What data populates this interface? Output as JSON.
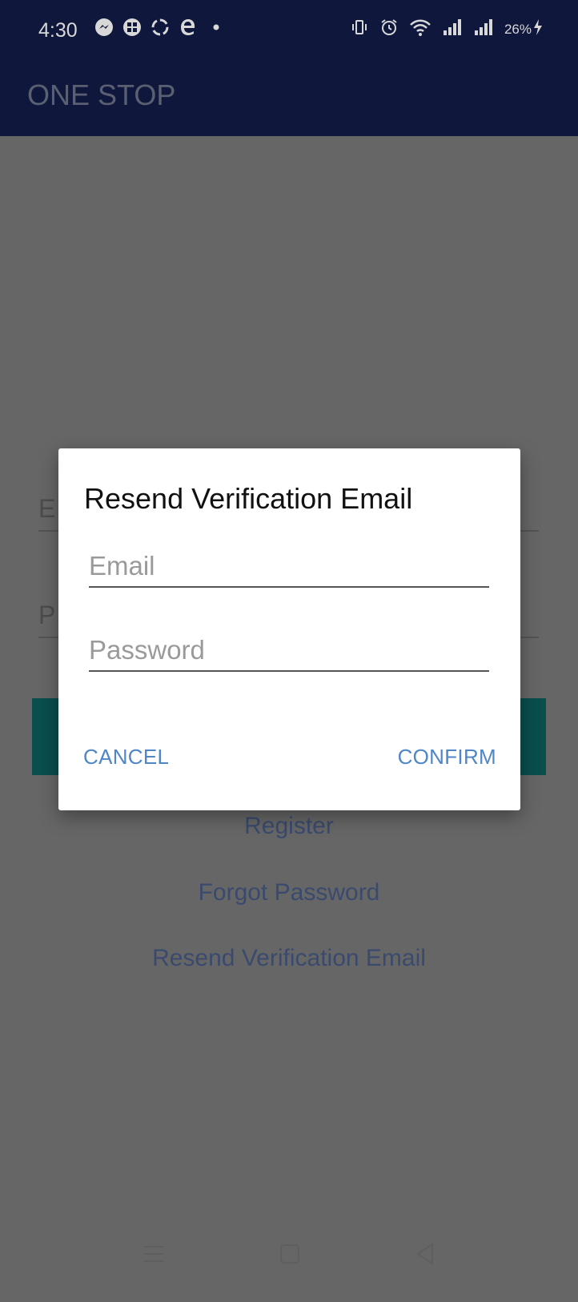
{
  "status_bar": {
    "time": "4:30",
    "battery": "26%",
    "notification_icons": [
      "messenger-icon",
      "grid-app-icon",
      "sync-app-icon",
      "edge-app-icon",
      "dot-icon"
    ],
    "system_icons": [
      "vibrate-icon",
      "alarm-icon",
      "wifi-icon",
      "signal-icon",
      "signal-icon"
    ]
  },
  "app_bar": {
    "title": "ONE STOP"
  },
  "background_form": {
    "email_hint": "E",
    "password_hint": "P",
    "links": {
      "register": "Register",
      "forgot_password": "Forgot Password",
      "resend_verification": "Resend Verification Email"
    }
  },
  "dialog": {
    "title": "Resend Verification Email",
    "email": {
      "value": "",
      "placeholder": "Email"
    },
    "password": {
      "value": "",
      "placeholder": "Password"
    },
    "buttons": {
      "cancel": "CANCEL",
      "confirm": "CONFIRM"
    }
  },
  "colors": {
    "app_bar": "#0f173d",
    "scrim_background": "#666666",
    "accent_button": "#4f86c6",
    "login_button_dimmed": "#0a4e4e"
  },
  "nav_bar": {
    "icons": [
      "menu-icon",
      "home-icon",
      "back-icon"
    ]
  }
}
